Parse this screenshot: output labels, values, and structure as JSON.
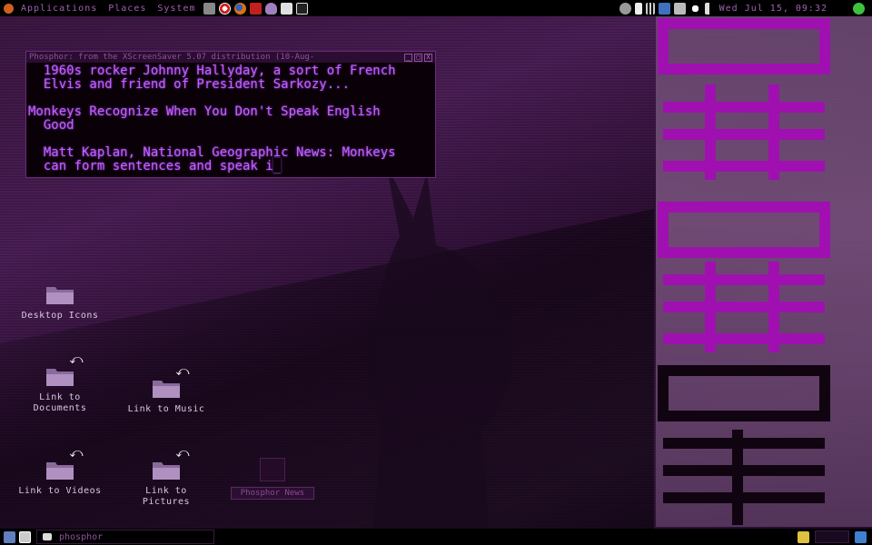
{
  "top_panel": {
    "menus": [
      "Applications",
      "Places",
      "System"
    ],
    "clock": "Wed Jul 15, 09:32"
  },
  "terminal": {
    "title": "Phosphor: from the XScreenSaver 5.07 distribution (10-Aug-",
    "btn_minimize": "_",
    "btn_maximize": "□",
    "btn_close": "X",
    "lines": [
      "  1960s rocker Johnny Hallyday, a sort of French",
      "  Elvis and friend of President Sarkozy...",
      "",
      "Monkeys Recognize When You Don't Speak English",
      "  Good",
      "",
      "  Matt Kaplan, National Geographic News: Monkeys"
    ],
    "last_line": "  can form sentences and speak i"
  },
  "desktop_icons": [
    {
      "label": "Desktop Icons",
      "link": false
    },
    {
      "label": "Link to\nDocuments",
      "link": true
    },
    {
      "label": "Link to Music",
      "link": true
    },
    {
      "label": "Link to Videos",
      "link": true
    },
    {
      "label": "Link to\nPictures",
      "link": true
    }
  ],
  "ghost_window_label": "Phosphor News",
  "bottom_panel": {
    "task_label": "phosphor"
  },
  "colors": {
    "phosphor_text": "#c060ff",
    "panel_bg": "#000000",
    "accent": "#a060b0"
  }
}
